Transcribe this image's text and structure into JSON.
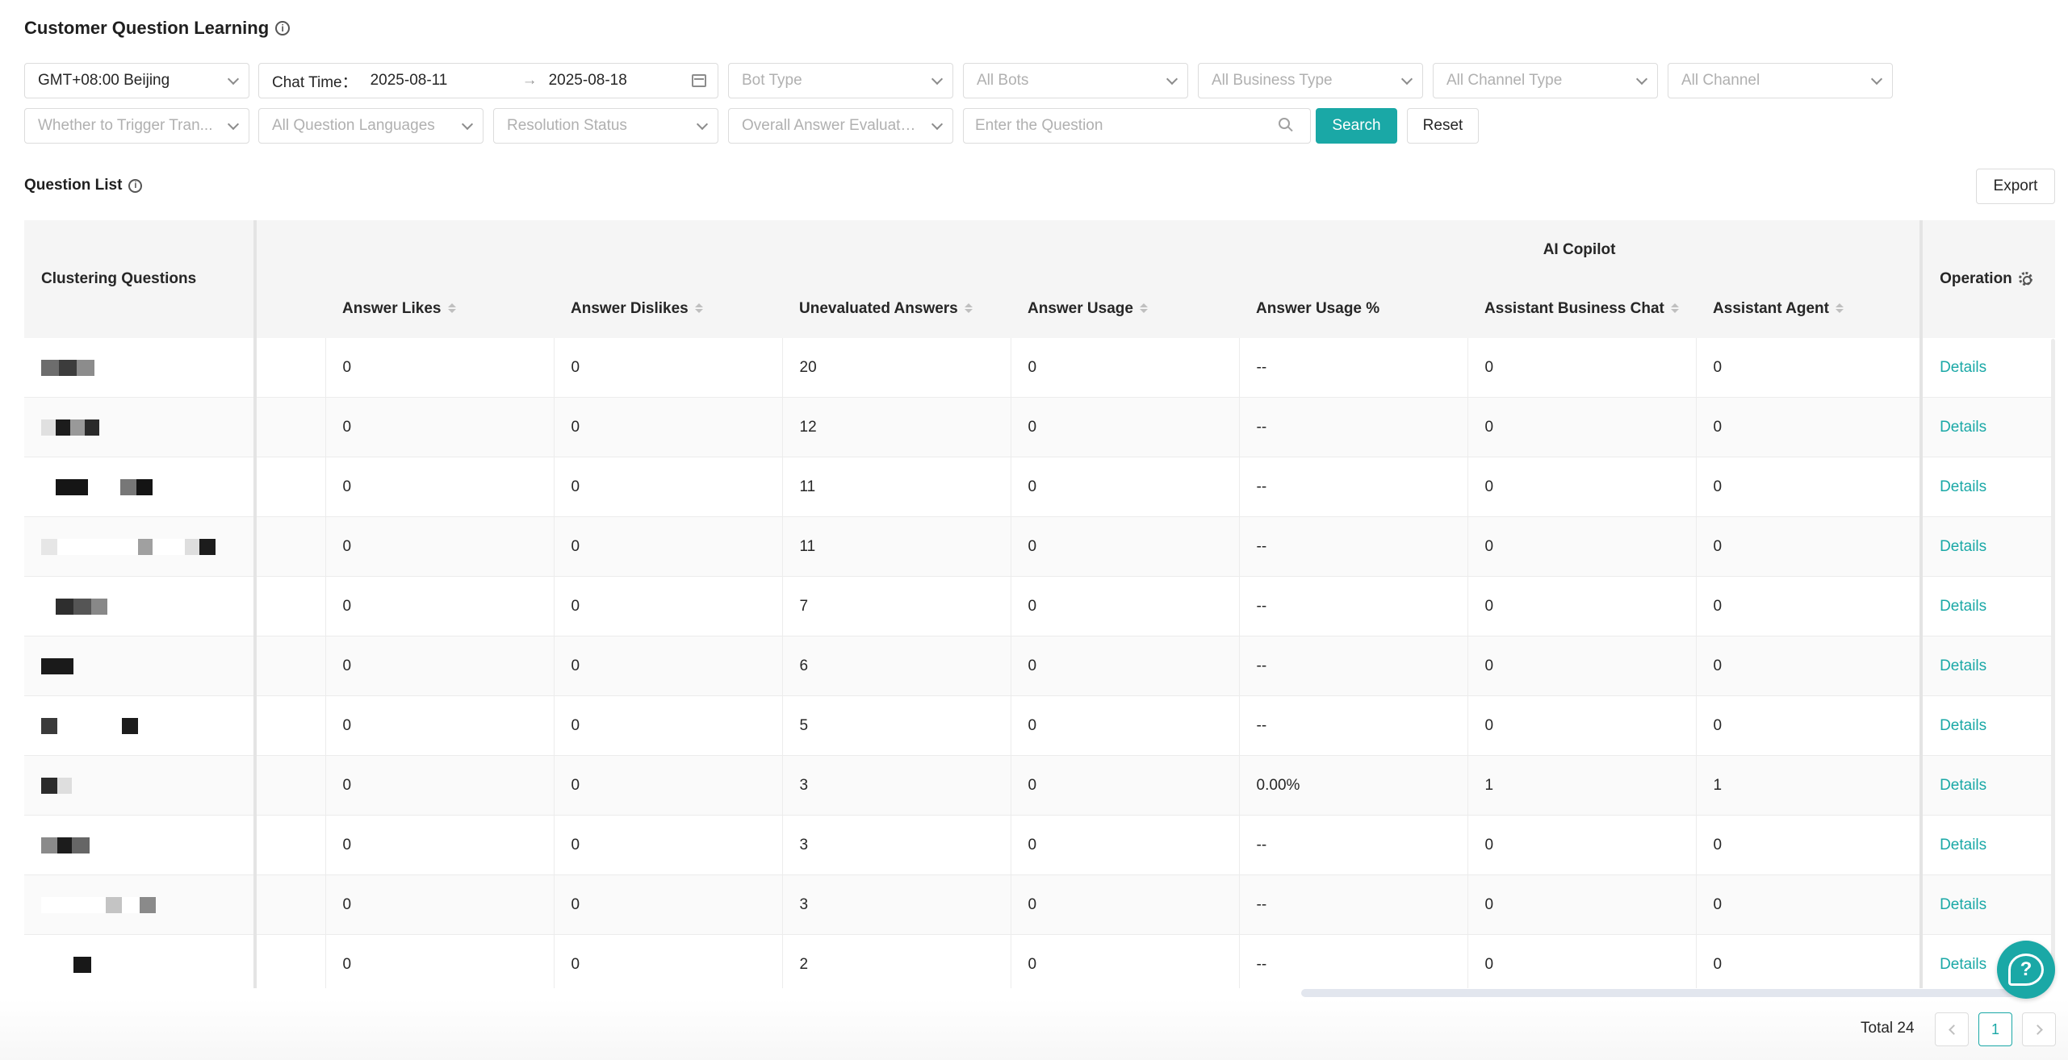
{
  "page": {
    "title": "Customer Question Learning"
  },
  "filters": {
    "timezone": "GMT+08:00 Beijing",
    "chat_time_label": "Chat Time：",
    "date_start": "2025-08-11",
    "date_arrow": "→",
    "date_end": "2025-08-18",
    "bot_type": "Bot Type",
    "all_bots": "All Bots",
    "business_type": "All Business Type",
    "channel_type": "All Channel Type",
    "channel": "All Channel",
    "trigger_transfer": "Whether to Trigger Tran...",
    "question_languages": "All Question Languages",
    "resolution_status": "Resolution Status",
    "answer_evaluation": "Overall Answer Evaluation",
    "question_placeholder": "Enter the Question",
    "search_label": "Search",
    "reset_label": "Reset"
  },
  "list": {
    "title": "Question List",
    "export_label": "Export",
    "group_header": "AI Copilot",
    "columns": {
      "clustering": "Clustering Questions",
      "likes": "Answer Likes",
      "dislikes": "Answer Dislikes",
      "unevaluated": "Unevaluated Answers",
      "usage": "Answer Usage",
      "usage_pct": "Answer Usage %",
      "assistant_business_chat": "Assistant Business Chat",
      "assistant_agent": "Assistant Agent",
      "operation": "Operation"
    },
    "details_label": "Details",
    "rows": [
      {
        "likes": "0",
        "dislikes": "0",
        "unevaluated": "20",
        "usage": "0",
        "usage_pct": "--",
        "business_chat": "0",
        "agent": "0"
      },
      {
        "likes": "0",
        "dislikes": "0",
        "unevaluated": "12",
        "usage": "0",
        "usage_pct": "--",
        "business_chat": "0",
        "agent": "0"
      },
      {
        "likes": "0",
        "dislikes": "0",
        "unevaluated": "11",
        "usage": "0",
        "usage_pct": "--",
        "business_chat": "0",
        "agent": "0"
      },
      {
        "likes": "0",
        "dislikes": "0",
        "unevaluated": "11",
        "usage": "0",
        "usage_pct": "--",
        "business_chat": "0",
        "agent": "0"
      },
      {
        "likes": "0",
        "dislikes": "0",
        "unevaluated": "7",
        "usage": "0",
        "usage_pct": "--",
        "business_chat": "0",
        "agent": "0"
      },
      {
        "likes": "0",
        "dislikes": "0",
        "unevaluated": "6",
        "usage": "0",
        "usage_pct": "--",
        "business_chat": "0",
        "agent": "0"
      },
      {
        "likes": "0",
        "dislikes": "0",
        "unevaluated": "5",
        "usage": "0",
        "usage_pct": "--",
        "business_chat": "0",
        "agent": "0"
      },
      {
        "likes": "0",
        "dislikes": "0",
        "unevaluated": "3",
        "usage": "0",
        "usage_pct": "0.00%",
        "business_chat": "1",
        "agent": "1"
      },
      {
        "likes": "0",
        "dislikes": "0",
        "unevaluated": "3",
        "usage": "0",
        "usage_pct": "--",
        "business_chat": "0",
        "agent": "0"
      },
      {
        "likes": "0",
        "dislikes": "0",
        "unevaluated": "3",
        "usage": "0",
        "usage_pct": "--",
        "business_chat": "0",
        "agent": "0"
      },
      {
        "likes": "0",
        "dislikes": "0",
        "unevaluated": "2",
        "usage": "0",
        "usage_pct": "--",
        "business_chat": "0",
        "agent": "0"
      }
    ]
  },
  "pagination": {
    "total": "Total 24",
    "current_page": "1"
  },
  "colors": {
    "accent": "#1aa8a6",
    "border": "#dcdcdc",
    "header_bg": "#f5f5f5"
  },
  "icons": {
    "info": "info-circle-icon",
    "chevron": "chevron-down-icon",
    "calendar": "calendar-icon",
    "search": "search-icon",
    "sort": "sort-icon",
    "gear": "gear-icon",
    "help": "help-chat-icon"
  }
}
